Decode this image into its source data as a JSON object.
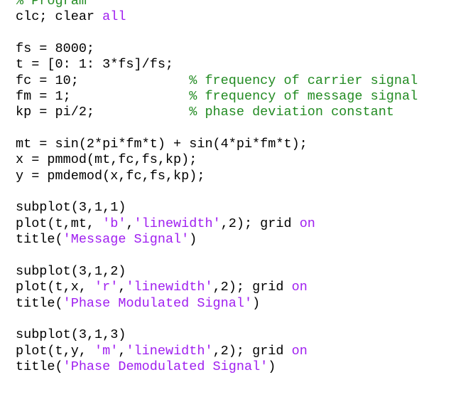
{
  "colors": {
    "plain": "#000000",
    "keyword": "#a020f0",
    "string": "#a020f0",
    "comment": "#228b22",
    "background": "#ffffff"
  },
  "lines": [
    [
      {
        "t": "comment",
        "v": "% Program"
      }
    ],
    [
      {
        "t": "plain",
        "v": "clc; clear "
      },
      {
        "t": "keyword",
        "v": "all"
      }
    ],
    [],
    [
      {
        "t": "plain",
        "v": "fs = 8000;"
      }
    ],
    [
      {
        "t": "plain",
        "v": "t = [0: 1: 3*fs]/fs;"
      }
    ],
    [
      {
        "t": "plain",
        "v": "fc = 10;              "
      },
      {
        "t": "comment",
        "v": "% frequency of carrier signal"
      }
    ],
    [
      {
        "t": "plain",
        "v": "fm = 1;               "
      },
      {
        "t": "comment",
        "v": "% frequency of message signal"
      }
    ],
    [
      {
        "t": "plain",
        "v": "kp = pi/2;            "
      },
      {
        "t": "comment",
        "v": "% phase deviation constant"
      }
    ],
    [],
    [
      {
        "t": "plain",
        "v": "mt = sin(2*pi*fm*t) + sin(4*pi*fm*t);"
      }
    ],
    [
      {
        "t": "plain",
        "v": "x = pmmod(mt,fc,fs,kp);"
      }
    ],
    [
      {
        "t": "plain",
        "v": "y = pmdemod(x,fc,fs,kp);"
      }
    ],
    [],
    [
      {
        "t": "plain",
        "v": "subplot(3,1,1)"
      }
    ],
    [
      {
        "t": "plain",
        "v": "plot(t,mt, "
      },
      {
        "t": "string",
        "v": "'b'"
      },
      {
        "t": "plain",
        "v": ","
      },
      {
        "t": "string",
        "v": "'linewidth'"
      },
      {
        "t": "plain",
        "v": ",2); grid "
      },
      {
        "t": "keyword",
        "v": "on"
      }
    ],
    [
      {
        "t": "plain",
        "v": "title("
      },
      {
        "t": "string",
        "v": "'Message Signal'"
      },
      {
        "t": "plain",
        "v": ")"
      }
    ],
    [],
    [
      {
        "t": "plain",
        "v": "subplot(3,1,2)"
      }
    ],
    [
      {
        "t": "plain",
        "v": "plot(t,x, "
      },
      {
        "t": "string",
        "v": "'r'"
      },
      {
        "t": "plain",
        "v": ","
      },
      {
        "t": "string",
        "v": "'linewidth'"
      },
      {
        "t": "plain",
        "v": ",2); grid "
      },
      {
        "t": "keyword",
        "v": "on"
      }
    ],
    [
      {
        "t": "plain",
        "v": "title("
      },
      {
        "t": "string",
        "v": "'Phase Modulated Signal'"
      },
      {
        "t": "plain",
        "v": ")"
      }
    ],
    [],
    [
      {
        "t": "plain",
        "v": "subplot(3,1,3)"
      }
    ],
    [
      {
        "t": "plain",
        "v": "plot(t,y, "
      },
      {
        "t": "string",
        "v": "'m'"
      },
      {
        "t": "plain",
        "v": ","
      },
      {
        "t": "string",
        "v": "'linewidth'"
      },
      {
        "t": "plain",
        "v": ",2); grid "
      },
      {
        "t": "keyword",
        "v": "on"
      }
    ],
    [
      {
        "t": "plain",
        "v": "title("
      },
      {
        "t": "string",
        "v": "'Phase Demodulated Signal'"
      },
      {
        "t": "plain",
        "v": ")"
      }
    ]
  ]
}
